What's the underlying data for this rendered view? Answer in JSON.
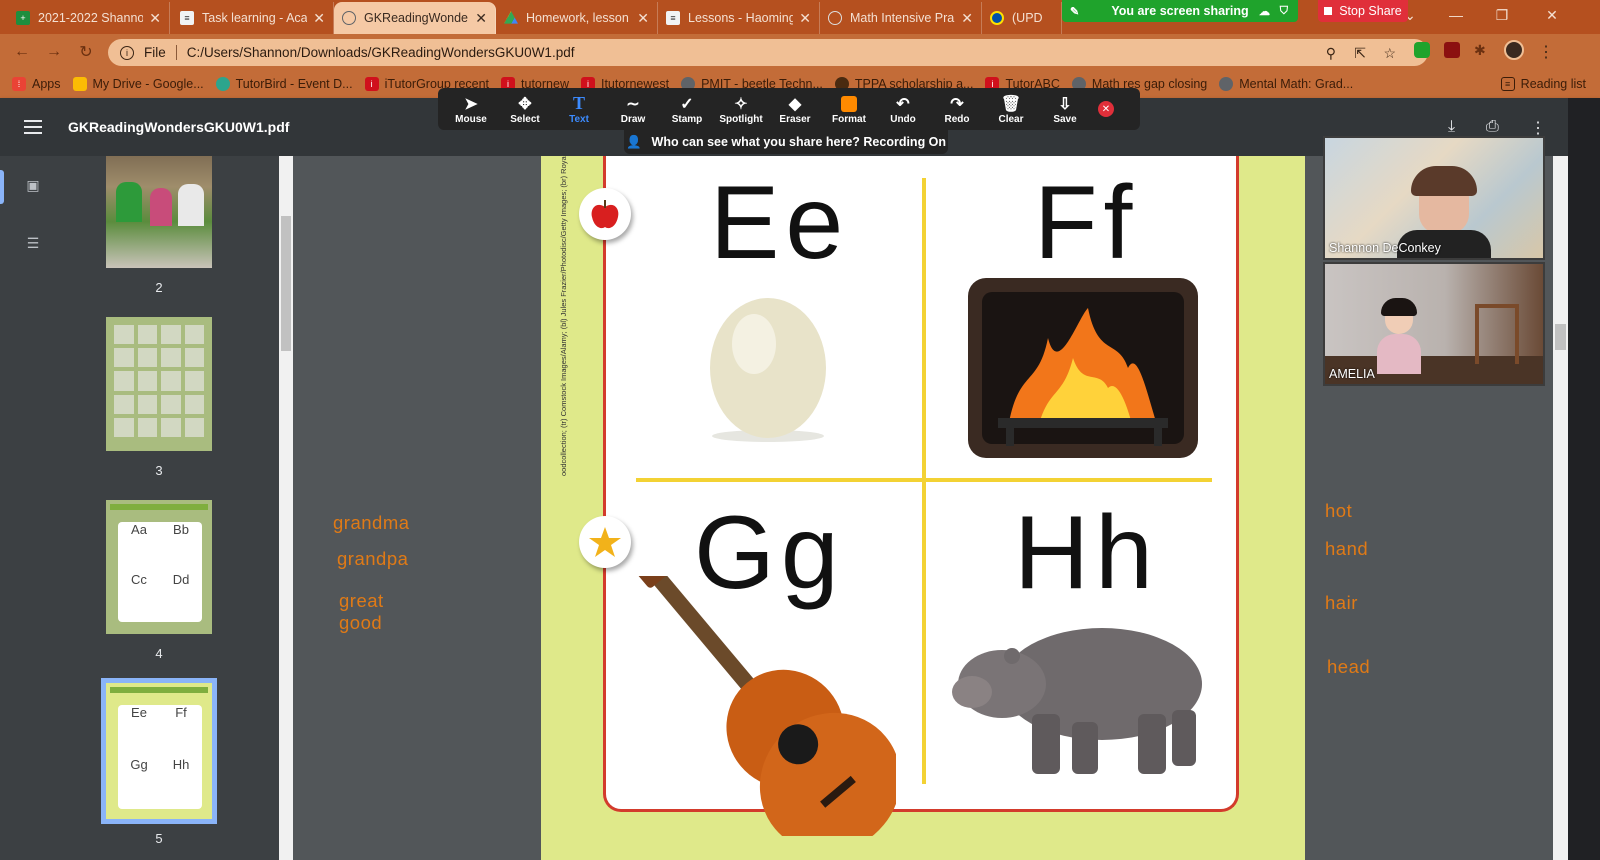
{
  "browser": {
    "tabs": [
      {
        "title": "2021-2022 Shanno",
        "favicon": "sheets-icon",
        "color": "#1e8e3e"
      },
      {
        "title": "Task learning - Aca",
        "favicon": "doc-icon",
        "color": "#f1f3f4"
      },
      {
        "title": "GKReadingWonde",
        "favicon": "globe-icon",
        "color": "#5f6368",
        "active": true
      },
      {
        "title": "Homework, lesson",
        "favicon": "drive-icon",
        "color": "#4285f4"
      },
      {
        "title": "Lessons - Haoming",
        "favicon": "doc-icon",
        "color": "#f1f3f4"
      },
      {
        "title": "Math Intensive Pra",
        "favicon": "globe-icon",
        "color": "#5f6368"
      },
      {
        "title": "(UPD",
        "favicon": "lidl-icon",
        "color": "#0050aa"
      }
    ],
    "address": {
      "scheme": "File",
      "url": "C:/Users/Shannon/Downloads/GKReadingWondersGKU0W1.pdf"
    },
    "bookmarks": [
      {
        "label": "Apps",
        "icon": "apps-grid-icon",
        "color": "#ea4335"
      },
      {
        "label": "My Drive - Google...",
        "icon": "drive-icon",
        "color": "#fbbc04"
      },
      {
        "label": "TutorBird - Event D...",
        "icon": "tutorbird-icon",
        "color": "#2ca58d"
      },
      {
        "label": "iTutorGroup recent",
        "icon": "itutor-icon",
        "color": "#d0101c"
      },
      {
        "label": "tutornew",
        "icon": "itutor-icon",
        "color": "#d0101c"
      },
      {
        "label": "Itutornewest",
        "icon": "itutor-icon",
        "color": "#d0101c"
      },
      {
        "label": "PMIT - beetle Techn...",
        "icon": "globe-icon",
        "color": "#5f6368"
      },
      {
        "label": "TPPA scholarship a...",
        "icon": "paw-icon",
        "color": "#4a2a10"
      },
      {
        "label": "TutorABC",
        "icon": "itutor-icon",
        "color": "#d0101c"
      },
      {
        "label": "Math res gap closing",
        "icon": "globe-icon",
        "color": "#5f6368"
      },
      {
        "label": "Mental Math: Grad...",
        "icon": "globe-icon",
        "color": "#5f6368"
      }
    ],
    "reading_list": "Reading list"
  },
  "zoom": {
    "sharing_text": "You are screen sharing",
    "stop_share": "Stop Share",
    "recording_text": "Who can see what you share here? Recording On",
    "tools": [
      {
        "label": "Mouse",
        "icon": "mouse-pointer-icon"
      },
      {
        "label": "Select",
        "icon": "move-arrows-icon"
      },
      {
        "label": "Text",
        "icon": "text-t-icon",
        "active": true
      },
      {
        "label": "Draw",
        "icon": "draw-wave-icon"
      },
      {
        "label": "Stamp",
        "icon": "checkmark-stamp-icon"
      },
      {
        "label": "Spotlight",
        "icon": "spotlight-wand-icon"
      },
      {
        "label": "Eraser",
        "icon": "eraser-icon"
      },
      {
        "label": "Format",
        "icon": "format-color-icon"
      },
      {
        "label": "Undo",
        "icon": "undo-icon"
      },
      {
        "label": "Redo",
        "icon": "redo-icon"
      },
      {
        "label": "Clear",
        "icon": "trash-icon"
      },
      {
        "label": "Save",
        "icon": "save-download-icon"
      }
    ],
    "participants": [
      {
        "name": "Shannon DeConkey"
      },
      {
        "name": "AMELIA"
      }
    ]
  },
  "pdf": {
    "title": "GKReadingWondersGKU0W1.pdf",
    "thumbnails": [
      {
        "page": "2"
      },
      {
        "page": "3"
      },
      {
        "page": "4",
        "letters": [
          "Aa",
          "Bb",
          "Cc",
          "Dd"
        ]
      },
      {
        "page": "5",
        "letters": [
          "Ee",
          "Ff",
          "Gg",
          "Hh"
        ],
        "selected": true
      }
    ],
    "card_letters": [
      "Ee",
      "Ff",
      "Gg",
      "Hh"
    ],
    "credit": "oodcollection; (tr) Comstock Images/Alamy; (bl) Jules Frazier/Photodisc/Getty Images; (br) Royalty-Free Corbis",
    "words_left": [
      "grandma",
      "grandpa",
      "great",
      "good"
    ],
    "words_right": [
      "hot",
      "hand",
      "hair",
      "head"
    ]
  }
}
